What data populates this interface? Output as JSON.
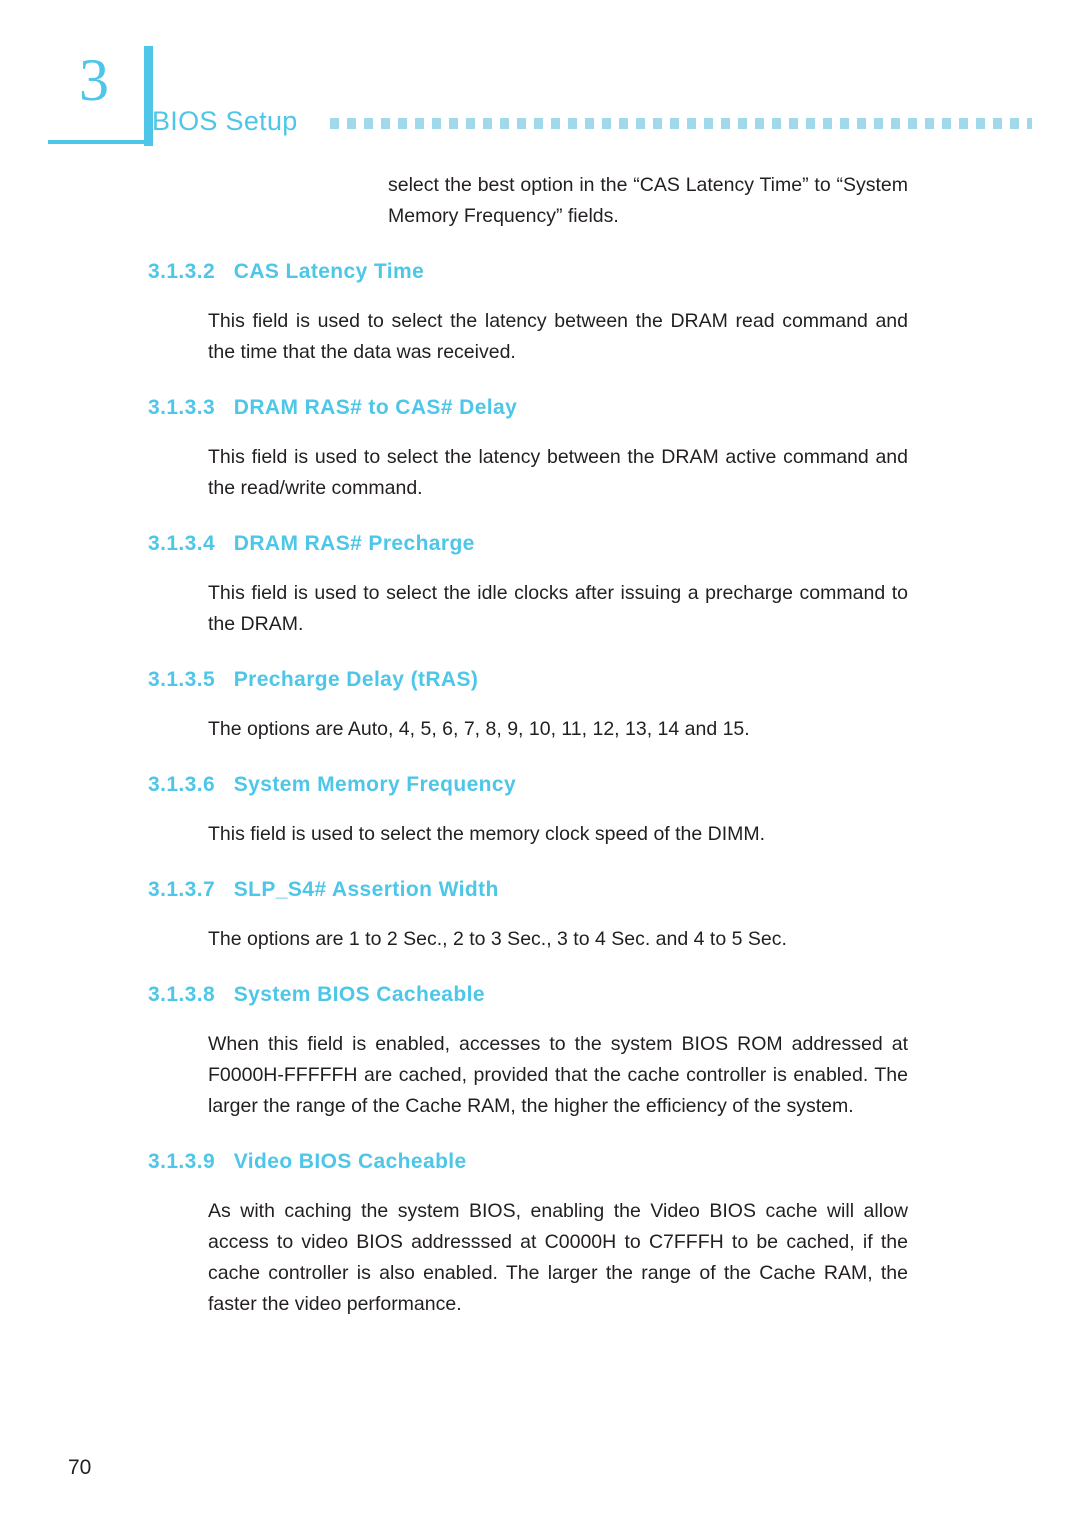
{
  "header": {
    "chapter_number": "3",
    "title": "BIOS Setup"
  },
  "intro_paragraph": "select the best option in the “CAS Latency Time” to “System Memory Frequency” fields.",
  "sections": [
    {
      "number": "3.1.3.2",
      "title": "CAS Latency Time",
      "body": "This field is used to select the latency between the DRAM read command and the time that the data was received."
    },
    {
      "number": "3.1.3.3",
      "title": "DRAM RAS# to CAS# Delay",
      "body": "This field is used to select the latency between the DRAM active command and the read/write command."
    },
    {
      "number": "3.1.3.4",
      "title": "DRAM RAS# Precharge",
      "body": "This field is used to select the idle clocks after issuing a precharge command to the DRAM."
    },
    {
      "number": "3.1.3.5",
      "title": "Precharge Delay (tRAS)",
      "body": "The options are Auto, 4, 5, 6, 7, 8, 9, 10, 11, 12, 13, 14 and 15."
    },
    {
      "number": "3.1.3.6",
      "title": "System Memory Frequency",
      "body": "This field is used to select the memory clock speed of the DIMM."
    },
    {
      "number": "3.1.3.7",
      "title": "SLP_S4# Assertion Width",
      "body": "The options are 1 to 2 Sec., 2 to 3 Sec., 3 to 4 Sec. and 4 to 5 Sec."
    },
    {
      "number": "3.1.3.8",
      "title": "System BIOS Cacheable",
      "body": "When this field is enabled, accesses to the system BIOS ROM addressed at F0000H-FFFFFH are cached, provided that the cache controller is enabled. The larger the range of the Cache RAM, the higher the efficiency of the system."
    },
    {
      "number": "3.1.3.9",
      "title": "Video BIOS Cacheable",
      "body": "As with caching the system BIOS, enabling the Video BIOS cache will allow access to video BIOS addresssed at C0000H to C7FFFH to be cached, if the cache controller is also enabled. The larger the range of the Cache RAM, the faster the video performance."
    }
  ],
  "page_number": "70",
  "colors": {
    "accent": "#4dc6e8",
    "text": "#231f20"
  }
}
